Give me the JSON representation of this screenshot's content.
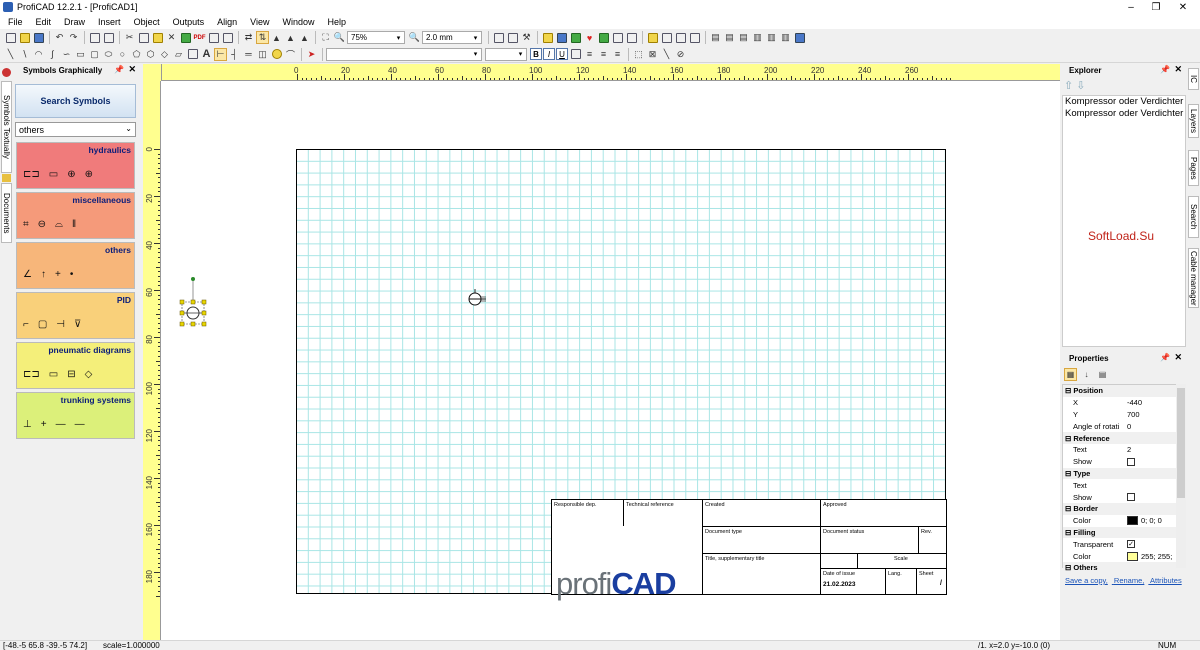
{
  "window": {
    "title": "ProfiCAD 12.2.1 - [ProfiCAD1]",
    "controls": [
      "–",
      "❐",
      "✕"
    ]
  },
  "menu": [
    "File",
    "Edit",
    "Draw",
    "Insert",
    "Object",
    "Outputs",
    "Align",
    "View",
    "Window",
    "Help"
  ],
  "toolbar": {
    "zoom": "75%",
    "grid": "2.0 mm",
    "font_name": "",
    "font_size": "",
    "bold": "B",
    "italic": "I",
    "underline": "U",
    "text_tool": "A"
  },
  "left_tabs": [
    "Symbols Textually",
    "Documents"
  ],
  "symbols_panel": {
    "title": "Symbols Graphically",
    "search_button": "Search Symbols",
    "category": "others",
    "categories": [
      {
        "name": "hydraulics",
        "color": "#f07b7b",
        "symbols": [
          "⊏⊐",
          "▭",
          "⊕",
          "⊕"
        ]
      },
      {
        "name": "miscellaneous",
        "color": "#f59a7a",
        "symbols": [
          "⌗",
          "⊖",
          "⌓",
          "‖"
        ]
      },
      {
        "name": "others",
        "color": "#f7b67a",
        "symbols": [
          "∠",
          "↑",
          "+",
          "•"
        ]
      },
      {
        "name": "PID",
        "color": "#f9d07a",
        "symbols": [
          "⌐",
          "▢",
          "⊣",
          "⊽"
        ]
      },
      {
        "name": "pneumatic diagrams",
        "color": "#f4ef7a",
        "symbols": [
          "⊏⊐",
          "▭",
          "⊟",
          "◇"
        ]
      },
      {
        "name": "trunking systems",
        "color": "#dcf07a",
        "symbols": [
          "⊥",
          "+",
          "—",
          "—"
        ]
      }
    ]
  },
  "rulers": {
    "h_labels": [
      "0",
      "20",
      "40",
      "60",
      "80",
      "100",
      "120",
      "140",
      "160",
      "180",
      "200",
      "220",
      "240",
      "260"
    ],
    "v_labels": [
      "0",
      "20",
      "40",
      "60",
      "80",
      "100",
      "120",
      "140",
      "160",
      "180"
    ]
  },
  "title_block": {
    "responsible_dep": "Responsible dep.",
    "technical_reference": "Technical reference",
    "created": "Created",
    "approved": "Approved",
    "document_type": "Document type",
    "document_status": "Document status",
    "rev": "Rev.",
    "title": "Title, supplementary title",
    "scale": "Scale",
    "date_of_issue_label": "Date of issue",
    "date_of_issue": "21.02.2023",
    "lang": "Lang.",
    "sheet": "Sheet",
    "sheet_value": "/",
    "logo_a": "profi",
    "logo_b": "CAD"
  },
  "right_tabs": [
    "IC",
    "Layers",
    "Pages",
    "Search",
    "Cable manager"
  ],
  "explorer": {
    "title": "Explorer",
    "items": [
      "Kompressor oder Verdichter",
      "Kompressor oder Verdichter"
    ],
    "watermark": "SoftLoad.Su"
  },
  "properties": {
    "title": "Properties",
    "rows": [
      {
        "group": "Position"
      },
      {
        "key": "X",
        "value": "-440"
      },
      {
        "key": "Y",
        "value": "700"
      },
      {
        "key": "Angle of rotatio",
        "value": "0"
      },
      {
        "group": "Reference"
      },
      {
        "key": "Text",
        "value": "2"
      },
      {
        "key": "Show",
        "check": false
      },
      {
        "group": "Type"
      },
      {
        "key": "Text",
        "value": ""
      },
      {
        "key": "Show",
        "check": false
      },
      {
        "group": "Border"
      },
      {
        "key": "Color",
        "value": "0; 0; 0",
        "swatch": "#000000"
      },
      {
        "group": "Filling"
      },
      {
        "key": "Transparent",
        "check": true
      },
      {
        "key": "Color",
        "value": "255; 255;",
        "swatch": "#ffff99"
      },
      {
        "group": "Others"
      }
    ],
    "links": [
      "Save a copy,",
      "Rename,",
      "Attributes"
    ]
  },
  "status": {
    "coords": "[-48.-5  65.8  -39.-5  74.2]",
    "scale": "scale=1.000000",
    "cursor": "/1.  x=2.0  y=-10.0 (0)",
    "num": "NUM"
  }
}
